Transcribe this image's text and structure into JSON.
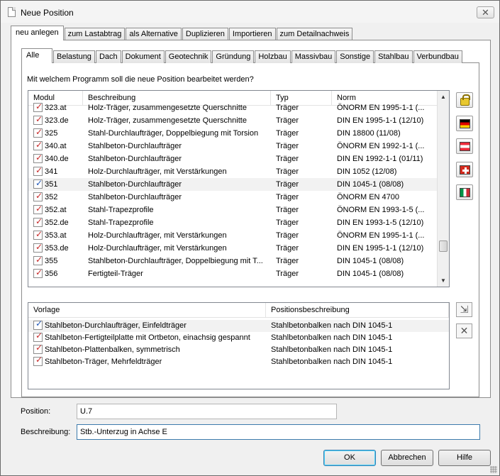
{
  "window": {
    "title": "Neue Position",
    "close_glyph": "✕"
  },
  "outer_tabs": [
    "neu anlegen",
    "zum Lastabtrag",
    "als Alternative",
    "Duplizieren",
    "Importieren",
    "zum Detailnachweis"
  ],
  "inner_tabs": [
    "Alle",
    "Belastung",
    "Dach",
    "Dokument",
    "Geotechnik",
    "Gründung",
    "Holzbau",
    "Massivbau",
    "Sonstige",
    "Stahlbau",
    "Verbundbau"
  ],
  "question": "Mit welchem Programm soll die neue Position bearbeitet werden?",
  "program_list": {
    "headers": {
      "modul": "Modul",
      "beschreibung": "Beschreibung",
      "typ": "Typ",
      "norm": "Norm"
    },
    "rows": [
      {
        "modul": "323.at",
        "beschreibung": "Holz-Träger, zusammengesetzte Querschnitte",
        "typ": "Träger",
        "norm": "ÖNORM EN 1995-1-1 (..."
      },
      {
        "modul": "323.de",
        "beschreibung": "Holz-Träger, zusammengesetzte Querschnitte",
        "typ": "Träger",
        "norm": "DIN EN 1995-1-1 (12/10)"
      },
      {
        "modul": "325",
        "beschreibung": "Stahl-Durchlaufträger, Doppelbiegung mit Torsion",
        "typ": "Träger",
        "norm": "DIN 18800 (11/08)"
      },
      {
        "modul": "340.at",
        "beschreibung": "Stahlbeton-Durchlaufträger",
        "typ": "Träger",
        "norm": "ÖNORM EN 1992-1-1 (..."
      },
      {
        "modul": "340.de",
        "beschreibung": "Stahlbeton-Durchlaufträger",
        "typ": "Träger",
        "norm": "DIN EN 1992-1-1 (01/11)"
      },
      {
        "modul": "341",
        "beschreibung": "Holz-Durchlaufträger, mit Verstärkungen",
        "typ": "Träger",
        "norm": "DIN 1052 (12/08)"
      },
      {
        "modul": "351",
        "beschreibung": "Stahlbeton-Durchlaufträger",
        "typ": "Träger",
        "norm": "DIN 1045-1 (08/08)"
      },
      {
        "modul": "352",
        "beschreibung": "Stahlbeton-Durchlaufträger",
        "typ": "Träger",
        "norm": "ÖNORM EN 4700"
      },
      {
        "modul": "352.at",
        "beschreibung": "Stahl-Trapezprofile",
        "typ": "Träger",
        "norm": "ÖNORM EN 1993-1-5 (..."
      },
      {
        "modul": "352.de",
        "beschreibung": "Stahl-Trapezprofile",
        "typ": "Träger",
        "norm": "DIN EN 1993-1-5 (12/10)"
      },
      {
        "modul": "353.at",
        "beschreibung": "Holz-Durchlaufträger, mit Verstärkungen",
        "typ": "Träger",
        "norm": "ÖNORM EN 1995-1-1 (..."
      },
      {
        "modul": "353.de",
        "beschreibung": "Holz-Durchlaufträger, mit Verstärkungen",
        "typ": "Träger",
        "norm": "DIN EN 1995-1-1 (12/10)"
      },
      {
        "modul": "355",
        "beschreibung": "Stahlbeton-Durchlaufträger, Doppelbiegung mit T...",
        "typ": "Träger",
        "norm": "DIN 1045-1 (08/08)"
      },
      {
        "modul": "356",
        "beschreibung": "Fertigteil-Träger",
        "typ": "Träger",
        "norm": "DIN 1045-1 (08/08)"
      }
    ]
  },
  "template_list": {
    "headers": {
      "vorlage": "Vorlage",
      "positionsbeschreibung": "Positionsbeschreibung"
    },
    "rows": [
      {
        "vorlage": "Stahlbeton-Durchlaufträger, Einfeldträger",
        "positionsbeschreibung": "Stahlbetonbalken nach DIN 1045-1"
      },
      {
        "vorlage": "Stahlbeton-Fertigteilplatte mit Ortbeton, einachsig gespannt",
        "positionsbeschreibung": "Stahlbetonbalken nach DIN 1045-1"
      },
      {
        "vorlage": "Stahlbeton-Plattenbalken, symmetrisch",
        "positionsbeschreibung": "Stahlbetonbalken nach DIN 1045-1"
      },
      {
        "vorlage": "Stahlbeton-Träger, Mehrfeldträger",
        "positionsbeschreibung": "Stahlbetonbalken nach DIN 1045-1"
      }
    ]
  },
  "side_icons": [
    "lock-icon",
    "flag-germany-icon",
    "flag-austria-icon",
    "flag-switzerland-icon",
    "flag-italy-icon"
  ],
  "template_tools": {
    "export_glyph": "⇲",
    "delete_glyph": "✕"
  },
  "form": {
    "position_label": "Position:",
    "position_value": "U.7",
    "beschreibung_label": "Beschreibung:",
    "beschreibung_value": "Stb.-Unterzug in Achse E"
  },
  "buttons": {
    "ok": "OK",
    "cancel": "Abbrechen",
    "help": "Hilfe"
  }
}
